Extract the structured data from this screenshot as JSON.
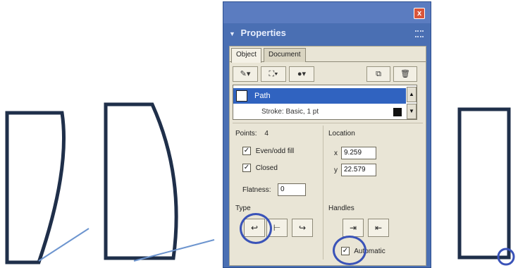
{
  "panel": {
    "title": "Properties",
    "close_glyph": "x",
    "tabs": [
      {
        "label": "Object",
        "active": true
      },
      {
        "label": "Document",
        "active": false
      }
    ],
    "toolbar": [
      {
        "icon": "pencil-icon",
        "glyph": "✎▾"
      },
      {
        "icon": "fill-bucket-icon",
        "glyph": "⛶▾"
      },
      {
        "icon": "effects-icon",
        "glyph": "●▾"
      },
      {
        "icon": "duplicate-icon",
        "glyph": "⧉"
      },
      {
        "icon": "trash-icon",
        "glyph": "🗑"
      }
    ],
    "object_list": {
      "selected": "Path",
      "stroke_row": "Stroke: Basic, 1 pt"
    },
    "points": {
      "label": "Points:",
      "value": "4"
    },
    "even_odd_fill": {
      "label": "Even/odd fill",
      "checked": true
    },
    "closed": {
      "label": "Closed",
      "checked": true
    },
    "flatness": {
      "label": "Flatness:",
      "value": "0"
    },
    "location": {
      "label": "Location",
      "x_label": "x",
      "x_value": "9.259",
      "y_label": "y",
      "y_value": "22.579"
    },
    "type": {
      "label": "Type"
    },
    "handles": {
      "label": "Handles"
    },
    "automatic": {
      "label": "Automatic",
      "checked": true
    },
    "check_glyph": "✓"
  },
  "colors": {
    "panel_blue": "#4a6fb3",
    "selection_blue": "#3063c0",
    "panel_bg": "#e9e5d6",
    "ring": "#3a53b8",
    "shape_stroke": "#1f2f4a",
    "handle_line": "#6d95cf"
  }
}
